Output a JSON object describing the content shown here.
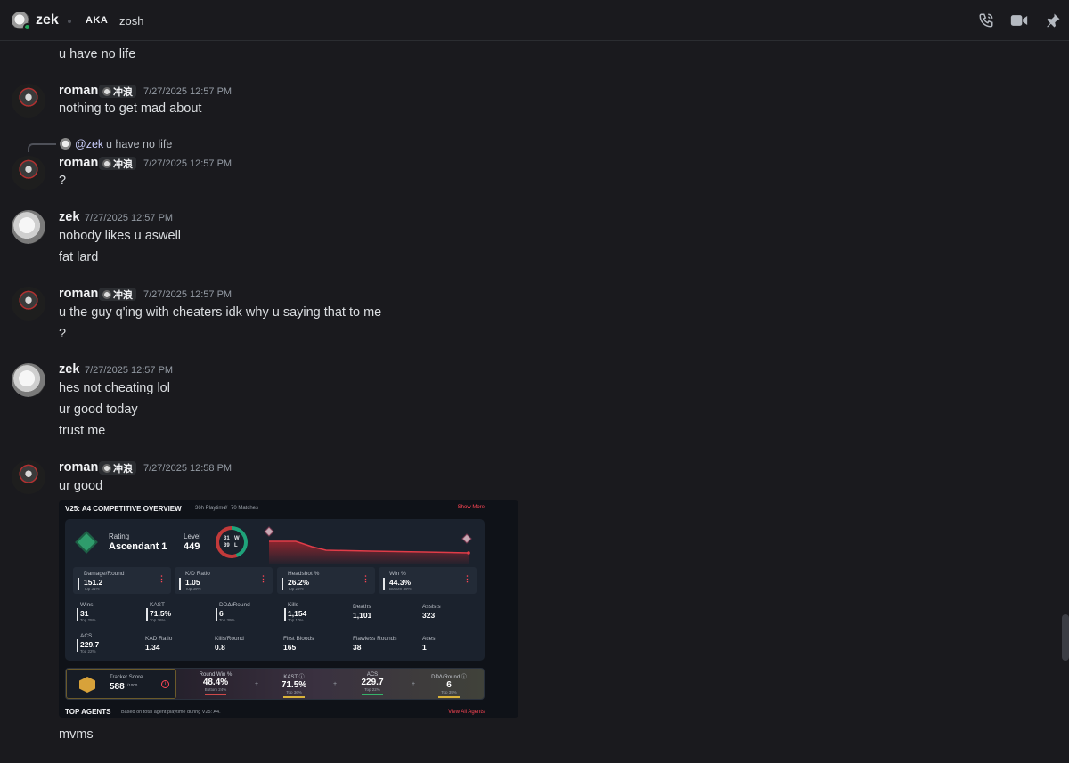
{
  "header": {
    "name": "zek",
    "aka_label": "AKA",
    "alias": "zosh"
  },
  "messages": [
    {
      "id": "m0",
      "text": "u have no life"
    },
    {
      "id": "m1",
      "author": "roman",
      "tag": "冲浪",
      "time": "7/27/2025 12:57 PM",
      "lines": [
        "nothing to get mad about"
      ]
    },
    {
      "id": "m2",
      "reply": {
        "mention": "@zek",
        "text": "u have no life"
      },
      "author": "roman",
      "tag": "冲浪",
      "time": "7/27/2025 12:57 PM",
      "lines": [
        "?"
      ]
    },
    {
      "id": "m3",
      "author": "zek",
      "time": "7/27/2025 12:57 PM",
      "lines": [
        "nobody likes u aswell",
        "fat lard"
      ]
    },
    {
      "id": "m4",
      "author": "roman",
      "tag": "冲浪",
      "time": "7/27/2025 12:57 PM",
      "lines": [
        "u the guy q'ing with cheaters idk why u saying that to me",
        "?"
      ]
    },
    {
      "id": "m5",
      "author": "zek",
      "time": "7/27/2025 12:57 PM",
      "lines": [
        "hes not cheating lol",
        "ur good today",
        "trust me"
      ]
    },
    {
      "id": "m6",
      "author": "roman",
      "tag": "冲浪",
      "time": "7/27/2025 12:58 PM",
      "lines": [
        "ur good"
      ],
      "after_image": "mvms"
    }
  ],
  "image_card": {
    "title": "V25: A4 COMPETITIVE OVERVIEW",
    "playtime": "36h Playtime",
    "matches": "70 Matches",
    "show_more": "Show More",
    "rating_label": "Rating",
    "rating_value": "Ascendant 1",
    "level_label": "Level",
    "level_value": "449",
    "wins": "31",
    "wins_short": "W",
    "losses": "39",
    "losses_short": "L",
    "win_fraction": 0.443,
    "top_boxes": [
      {
        "label": "Damage/Round",
        "value": "151.2",
        "sub": "Top 31%"
      },
      {
        "label": "K/D Ratio",
        "value": "1.05",
        "sub": "Top 39%"
      },
      {
        "label": "Headshot %",
        "value": "26.2%",
        "sub": "Top 25%"
      },
      {
        "label": "Win %",
        "value": "44.3%",
        "sub": "Bottom 39%"
      }
    ],
    "stats": [
      {
        "label": "Wins",
        "value": "31",
        "sub": "Top 25%"
      },
      {
        "label": "KAST",
        "value": "71.5%",
        "sub": "Top 36%"
      },
      {
        "label": "DDΔ/Round",
        "value": "6",
        "sub": "Top 39%"
      },
      {
        "label": "Kills",
        "value": "1,154",
        "sub": "Top 10%"
      },
      {
        "label": "Deaths",
        "value": "1,101",
        "sub": ""
      },
      {
        "label": "Assists",
        "value": "323",
        "sub": ""
      },
      {
        "label": "ACS",
        "value": "229.7",
        "sub": "Top 22%"
      },
      {
        "label": "KAD Ratio",
        "value": "1.34",
        "sub": ""
      },
      {
        "label": "Kills/Round",
        "value": "0.8",
        "sub": ""
      },
      {
        "label": "First Bloods",
        "value": "165",
        "sub": ""
      },
      {
        "label": "Flawless Rounds",
        "value": "38",
        "sub": ""
      },
      {
        "label": "Aces",
        "value": "1",
        "sub": ""
      }
    ],
    "tracker": {
      "label": "Tracker Score",
      "value": "588",
      "max": "/1000",
      "stats": [
        {
          "label": "Round Win %",
          "value": "48.4%",
          "sub": "Bottom 24%",
          "color": "#d04a4a"
        },
        {
          "label": "KAST ⓘ",
          "value": "71.5%",
          "sub": "Top 36%",
          "color": "#d8b23a"
        },
        {
          "label": "ACS",
          "value": "229.7",
          "sub": "Top 22%",
          "color": "#36b36a"
        },
        {
          "label": "DDΔ/Round ⓘ",
          "value": "6",
          "sub": "Top 39%",
          "color": "#d8b23a"
        }
      ]
    },
    "top_agents": "TOP AGENTS",
    "top_agents_sub": "Based on total agent playtime during V25: A4.",
    "view_all": "View All Agents"
  },
  "icons": {
    "call": "phone-call-icon",
    "video": "video-camera-icon",
    "pin": "pin-icon"
  }
}
